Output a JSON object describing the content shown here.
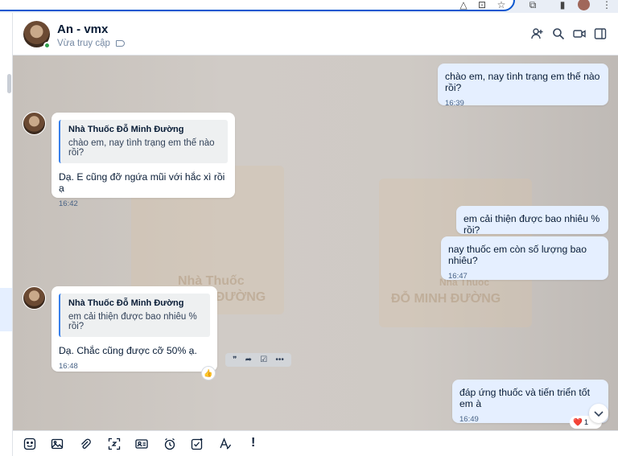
{
  "conversation": {
    "name": "An - vmx",
    "status": "Vừa truy cập"
  },
  "messages": [
    {
      "id": "m1",
      "direction": "out",
      "text": "chào em, nay tình trạng em thế nào rồi?",
      "time": "16:39"
    },
    {
      "id": "m2",
      "direction": "in",
      "quote": {
        "sender": "Nhà Thuốc Đỗ Minh Đường",
        "text": "chào em, nay tình trạng em thế nào rồi?"
      },
      "text": "Dạ. E cũng đỡ ngứa mũi với hắc xì rồi ạ",
      "time": "16:42"
    },
    {
      "id": "m3",
      "direction": "out",
      "text": "em cải thiện được bao nhiêu % rồi?"
    },
    {
      "id": "m4",
      "direction": "out",
      "text": "nay thuốc em còn số lượng bao nhiêu?",
      "time": "16:47"
    },
    {
      "id": "m5",
      "direction": "in",
      "quote": {
        "sender": "Nhà Thuốc Đỗ Minh Đường",
        "text": "em cải thiện được bao nhiêu % rồi?"
      },
      "text": "Dạ. Chắc cũng được cỡ 50% ạ.",
      "time": "16:48"
    },
    {
      "id": "m6",
      "direction": "out",
      "text": "đáp ứng thuốc và tiến triển tốt em à",
      "time": "16:49",
      "reaction": {
        "emoji": "❤️",
        "count": "1"
      }
    }
  ],
  "watermark": {
    "brand_line1": "Nhà Thuốc",
    "brand_line2": "ĐỖ MINH ĐƯỜNG"
  },
  "header_actions": [
    "add-member-icon",
    "search-icon",
    "video-call-icon",
    "toggle-sidebar-icon"
  ],
  "toolbar_icons": [
    "sticker-icon",
    "image-icon",
    "attachment-icon",
    "screenshot-icon",
    "contact-card-icon",
    "reminder-icon",
    "task-icon",
    "text-format-icon",
    "urgent-icon"
  ],
  "colors": {
    "accent": "#0b57d0",
    "outgoing_bubble": "#e5efff",
    "incoming_bubble": "#ffffff",
    "online": "#30a14e",
    "quote_bar": "#3880eb"
  }
}
